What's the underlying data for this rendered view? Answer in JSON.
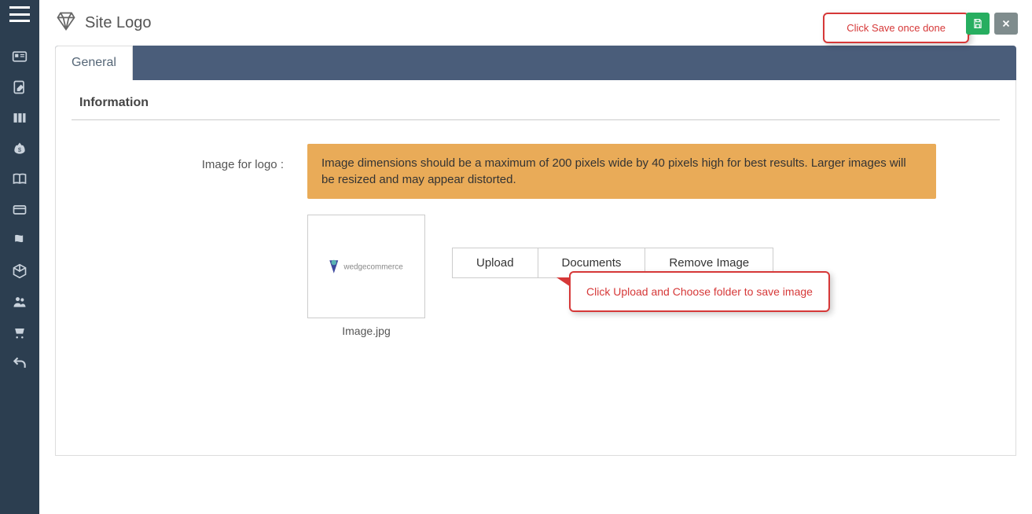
{
  "header": {
    "title": "Site Logo",
    "tooltip_save": "Click Save once done"
  },
  "tabs": {
    "general": "General"
  },
  "section": {
    "title": "Information"
  },
  "form": {
    "label_image": "Image for logo :",
    "info_text": "Image dimensions should be a maximum of 200 pixels wide by 40 pixels high for best results. Larger images will be resized and may appear distorted.",
    "filename": "Image.jpg",
    "btn_upload": "Upload",
    "btn_documents": "Documents",
    "btn_remove": "Remove Image",
    "tooltip_upload": "Click Upload and Choose folder to save image",
    "preview_logo_text": "wedgecommerce"
  }
}
